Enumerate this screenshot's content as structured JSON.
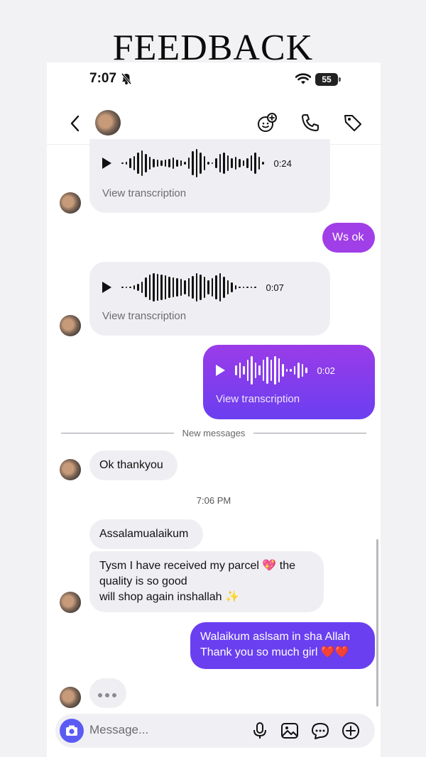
{
  "banner": {
    "title": "FEEDBACK"
  },
  "status_bar": {
    "time": "7:07",
    "battery": "55"
  },
  "chat": {
    "voice_messages": [
      {
        "duration": "0:24",
        "transcription_label": "View transcription"
      },
      {
        "duration": "0:07",
        "transcription_label": "View transcription"
      },
      {
        "duration": "0:02",
        "transcription_label": "View transcription"
      }
    ],
    "messages": {
      "ws_ok": "Ws ok",
      "ok_thankyou": "Ok thankyou",
      "salam": "Assalamualaikum",
      "received_line1": "Tysm I have received my parcel 💖 the",
      "received_line2": "quality is so good",
      "received_line3": "will shop again inshallah ✨",
      "reply_line1": "Walaikum aslsam in sha Allah",
      "reply_line2": "Thank you so much girl ❤️❤️"
    },
    "divider_label": "New messages",
    "timestamp": "7:06 PM"
  },
  "composer": {
    "placeholder": "Message..."
  },
  "colors": {
    "outgoing_top": "#9b3be8",
    "outgoing_bottom": "#6a3ff0",
    "camera": "#5b5bf4",
    "incoming_bg": "#efeff3"
  },
  "icons": [
    "back-chevron-icon",
    "video-chat-icon",
    "phone-icon",
    "tag-icon",
    "camera-icon",
    "microphone-icon",
    "gallery-icon",
    "sticker-icon",
    "plus-icon"
  ]
}
